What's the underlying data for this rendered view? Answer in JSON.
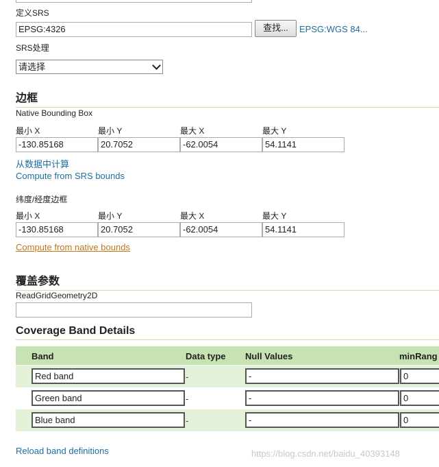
{
  "srs": {
    "declared_label": "定义SRS",
    "declared_value": "EPSG:4326",
    "find_button": "查找...",
    "srs_link": "EPSG:WGS 84...",
    "handling_label": "SRS处理",
    "handling_value": "请选择"
  },
  "bbox": {
    "title": "边框",
    "native_label": "Native Bounding Box",
    "col_labels": [
      "最小 X",
      "最小 Y",
      "最大 X",
      "最大 Y"
    ],
    "native_values": [
      "-130.85168",
      "20.7052",
      "-62.0054",
      "54.1141"
    ],
    "compute_from_data": "从数据中计算",
    "compute_from_srs": "Compute from SRS bounds",
    "latlon_label": "纬度/经度边框",
    "latlon_values": [
      "-130.85168",
      "20.7052",
      "-62.0054",
      "54.1141"
    ],
    "compute_from_native": "Compute from native bounds"
  },
  "coverage": {
    "title": "覆盖参数",
    "param_label": "ReadGridGeometry2D",
    "param_value": ""
  },
  "bands": {
    "title": "Coverage Band Details",
    "headers": [
      "Band",
      "Data type",
      "Null Values",
      "minRang"
    ],
    "rows": [
      {
        "name": "Red band",
        "type": "-",
        "nulls": "-",
        "min": "0"
      },
      {
        "name": "Green band",
        "type": "-",
        "nulls": "-",
        "min": "0"
      },
      {
        "name": "Blue band",
        "type": "-",
        "nulls": "-",
        "min": "0"
      }
    ],
    "reload": "Reload band definitions"
  },
  "watermark": "https://blog.csdn.net/baidu_40393148",
  "colors": {
    "accent_green": "#c8e3b3",
    "row_alt": "#e4f1d9",
    "link_blue": "#1f6d9e",
    "link_orange": "#c0761a"
  }
}
